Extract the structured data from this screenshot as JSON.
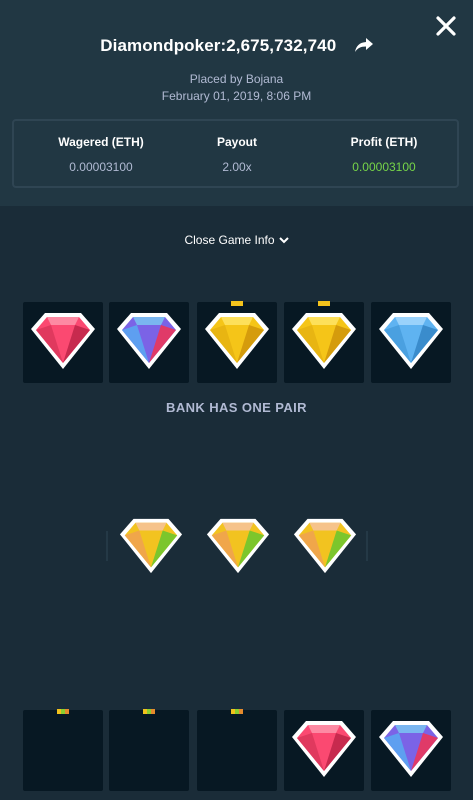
{
  "header": {
    "title": "Diamondpoker:2,675,732,740",
    "placed_by": "Placed by Bojana",
    "date": "February 01, 2019, 8:06 PM"
  },
  "stats": {
    "wagered_label": "Wagered (ETH)",
    "wagered_value": "0.00003100",
    "payout_label": "Payout",
    "payout_value": "2.00x",
    "profit_label": "Profit (ETH)",
    "profit_value": "0.00003100"
  },
  "toggle_label": "Close Game Info",
  "bank": {
    "gems": [
      "red",
      "purple",
      "yellow",
      "yellow",
      "blue"
    ],
    "result": "BANK HAS ONE PAIR"
  },
  "center_gems": [
    "orange",
    "orange",
    "orange"
  ],
  "player": {
    "gems": [
      "hidden",
      "hidden",
      "hidden",
      "red",
      "purple"
    ]
  },
  "colors": {
    "background": "#1a2c38",
    "header": "#213743",
    "card": "#071823",
    "profit_green": "#76d448",
    "muted_text": "#b1bad3"
  },
  "icons": [
    "close-icon",
    "share-icon",
    "chevron-down-icon"
  ]
}
